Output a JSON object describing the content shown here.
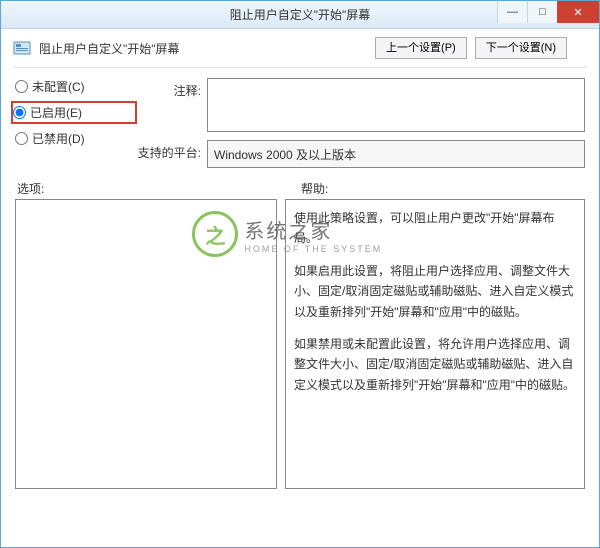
{
  "window": {
    "title": "阻止用户自定义\"开始\"屏幕"
  },
  "winbuttons": {
    "min": "—",
    "max": "□",
    "close": "✕"
  },
  "subheader": {
    "title": "阻止用户自定义\"开始\"屏幕"
  },
  "nav": {
    "prev": "上一个设置(P)",
    "next": "下一个设置(N)"
  },
  "radios": {
    "not_configured": "未配置(C)",
    "enabled": "已启用(E)",
    "disabled": "已禁用(D)",
    "selected": "enabled"
  },
  "labels": {
    "comment": "注释:",
    "platform": "支持的平台:",
    "options": "选项:",
    "help": "帮助:"
  },
  "comment_value": "",
  "platform_value": "Windows 2000 及以上版本",
  "options_value": "",
  "help_paragraphs": [
    "使用此策略设置，可以阻止用户更改\"开始\"屏幕布局。",
    "如果启用此设置，将阻止用户选择应用、调整文件大小、固定/取消固定磁贴或辅助磁贴、进入自定义模式以及重新排列\"开始\"屏幕和\"应用\"中的磁贴。",
    "如果禁用或未配置此设置，将允许用户选择应用、调整文件大小、固定/取消固定磁贴或辅助磁贴、进入自定义模式以及重新排列\"开始\"屏幕和\"应用\"中的磁贴。"
  ],
  "watermark": {
    "cn": "系统之家",
    "en": "HOME OF THE SYSTEM",
    "glyph": "之"
  }
}
